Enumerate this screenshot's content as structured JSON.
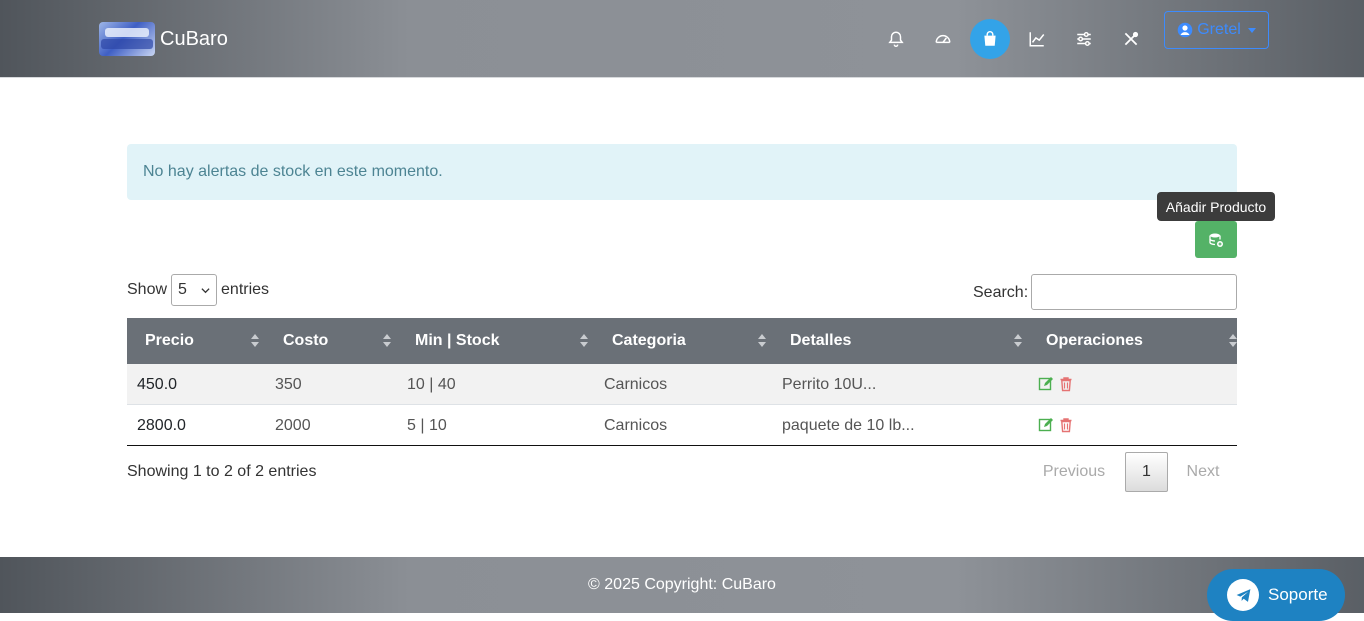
{
  "navbar": {
    "brand": "CuBaro",
    "icons": [
      "bell-icon",
      "speedometer-icon",
      "bag-icon",
      "chart-line-icon",
      "sliders-icon",
      "tools-icon"
    ],
    "active_icon": "bag-icon",
    "user": "Gretel",
    "accent": "#3d8bfd"
  },
  "alert": {
    "text": "No hay alertas de stock en este momento."
  },
  "add_product": {
    "tooltip": "Añadir Producto",
    "color": "#54b267"
  },
  "controls": {
    "show_label": "Show",
    "entries_value": "5",
    "entries_label": "entries",
    "search_label": "Search:",
    "search_value": ""
  },
  "table": {
    "columns": [
      "Precio",
      "Costo",
      "Min | Stock",
      "Categoria",
      "Detalles",
      "Operaciones"
    ],
    "rows": [
      {
        "precio": "450.0",
        "costo": "350",
        "min_stock": "10 | 40",
        "categoria": "Carnicos",
        "detalles": "Perrito 10U..."
      },
      {
        "precio": "2800.0",
        "costo": "2000",
        "min_stock": "5 | 10",
        "categoria": "Carnicos",
        "detalles": "paquete de 10 lb..."
      }
    ]
  },
  "pagination": {
    "info": "Showing 1 to 2 of 2 entries",
    "previous": "Previous",
    "current": "1",
    "next": "Next"
  },
  "footer": {
    "copyright": "© 2025 Copyright: CuBaro"
  },
  "support": {
    "label": "Soporte",
    "color": "#1e82c2"
  }
}
